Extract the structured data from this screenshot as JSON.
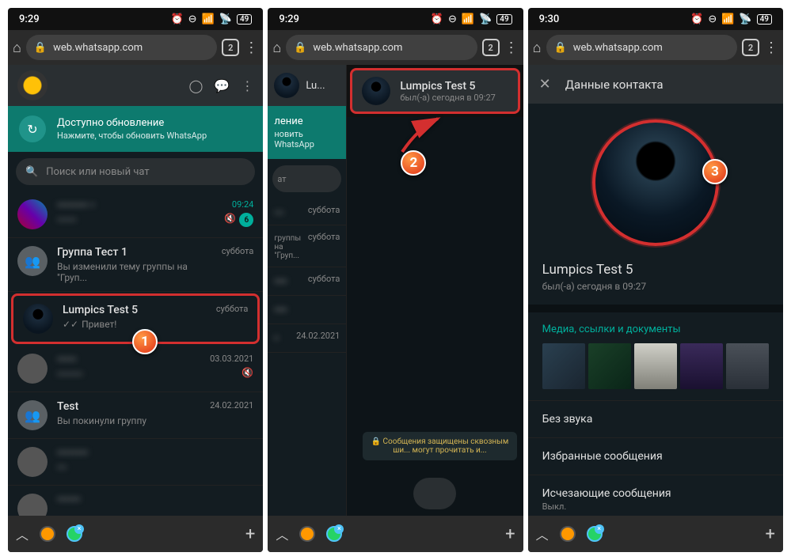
{
  "status": {
    "time1": "9:29",
    "time2": "9:29",
    "time3": "9:30",
    "battery": "49"
  },
  "browser": {
    "url": "web.whatsapp.com",
    "tabs": "2"
  },
  "wa": {
    "update_title": "Доступно обновление",
    "update_sub": "Нажмите, чтобы обновить WhatsApp",
    "update_sub_cut": "новить WhatsApp",
    "update_title_cut": "ление",
    "search": "Поиск или новый чат",
    "chats": [
      {
        "name": "•••••••• •",
        "msg": "••••••",
        "time": "09:24",
        "badge": "6",
        "blurred": true
      },
      {
        "name": "Группа Тест 1",
        "msg": "Вы изменили тему группы на \"Груп...",
        "time": "суббота"
      },
      {
        "name": "Lumpics Test 5",
        "msg": "Привет!",
        "time": "суббота",
        "ticks": true,
        "highlighted": true
      },
      {
        "name": "•••••",
        "msg": "••••••••",
        "time": "03.03.2021",
        "blurred": true
      },
      {
        "name": "Test",
        "msg": "Вы покинули группу",
        "time": "24.02.2021"
      },
      {
        "name": "••••••••",
        "msg": "•••",
        "time": "",
        "blurred": true
      },
      {
        "name": "••••••",
        "msg": "",
        "time": "",
        "blurred": true
      }
    ]
  },
  "chat": {
    "name": "Lumpics Test 5",
    "name_cut": "Lu...",
    "status": "был(-а) сегодня в 09:27",
    "encryption": "🔒 Сообщения защищены сквозным ши... могут прочитать и..."
  },
  "contact": {
    "header": "Данные контакта",
    "name": "Lumpics Test 5",
    "status": "был(-а) сегодня в 09:27",
    "media": "Медиа, ссылки и документы",
    "mute": "Без звука",
    "starred": "Избранные сообщения",
    "disappearing": "Исчезающие сообщения",
    "off": "Выкл."
  },
  "steps": {
    "s1": "1",
    "s2": "2",
    "s3": "3"
  }
}
